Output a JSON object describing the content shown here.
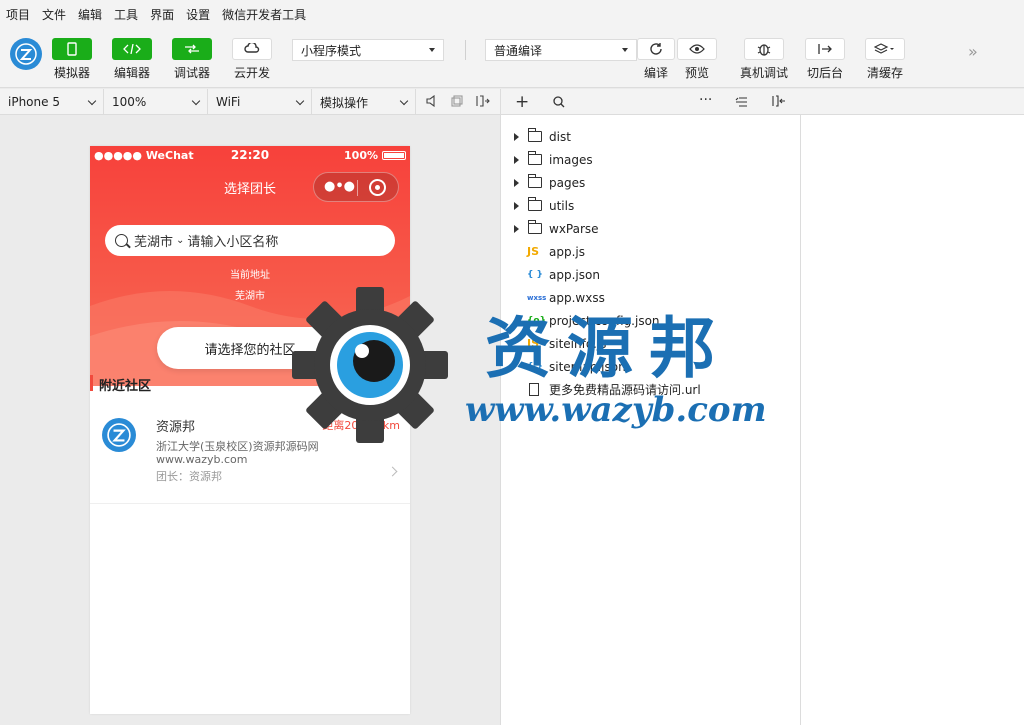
{
  "menu": [
    "项目",
    "文件",
    "编辑",
    "工具",
    "界面",
    "设置",
    "微信开发者工具"
  ],
  "toolbar": {
    "simulator": "模拟器",
    "editor": "编辑器",
    "debugger": "调试器",
    "cloud": "云开发",
    "mode": "小程序模式",
    "compile_mode": "普通编译",
    "compile": "编译",
    "preview": "预览",
    "remote_debug": "真机调试",
    "background": "切后台",
    "clear_cache": "清缓存"
  },
  "subbar": {
    "device": "iPhone 5",
    "zoom": "100%",
    "network": "WiFi",
    "operation": "模拟操作"
  },
  "phone": {
    "status_left": "●●●●● WeChat",
    "time": "22:20",
    "battery": "100%",
    "nav_title": "选择团长",
    "search_city": "芜湖市",
    "search_placeholder": "请输入小区名称",
    "current_label": "当前地址",
    "current_city": "芜湖市",
    "choose_btn": "请选择您的社区",
    "nearby_title": "附近社区",
    "card": {
      "name": "资源邦",
      "distance": "距离2017.4km",
      "address": "浙江大学(玉泉校区)资源邦源码网",
      "site": "www.wazyb.com",
      "leader": "团长：资源邦"
    }
  },
  "files": [
    {
      "type": "folder",
      "name": "dist"
    },
    {
      "type": "folder",
      "name": "images"
    },
    {
      "type": "folder",
      "name": "pages"
    },
    {
      "type": "folder",
      "name": "utils"
    },
    {
      "type": "folder",
      "name": "wxParse"
    },
    {
      "type": "js",
      "icon": "JS",
      "name": "app.js"
    },
    {
      "type": "json",
      "icon": "{ }",
      "name": "app.json"
    },
    {
      "type": "wxss",
      "icon": "wxss",
      "name": "app.wxss"
    },
    {
      "type": "cfg",
      "icon": "{o}",
      "name": "project.config.json"
    },
    {
      "type": "js",
      "icon": "JS",
      "name": "siteinfo.js"
    },
    {
      "type": "json",
      "icon": "{ }",
      "name": "sitemap.json"
    },
    {
      "type": "doc",
      "name": "更多免费精品源码请访问.url"
    }
  ],
  "watermark": {
    "title": "资源邦",
    "url": "www.wazyb.com"
  },
  "colors": {
    "accent_green": "#1aad19",
    "hero_red": "#f7413b",
    "watermark_blue": "#1b6fb3"
  }
}
